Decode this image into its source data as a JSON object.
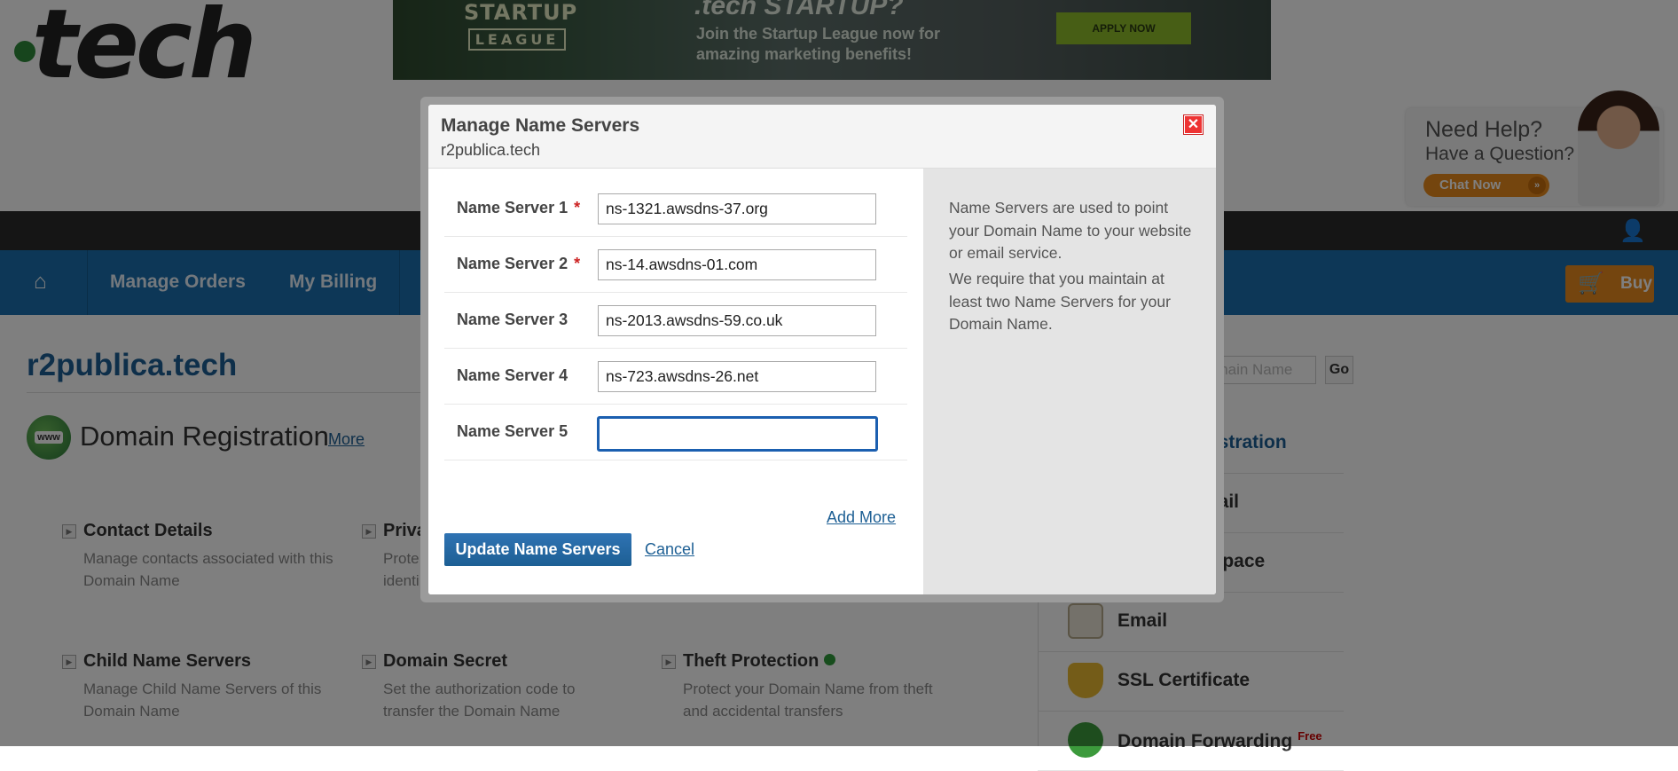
{
  "brand": {
    "logo_text": "tech"
  },
  "banner": {
    "league_line1": "STARTUP",
    "league_line2": "LEAGUE",
    "headline": ".tech STARTUP?",
    "subtext_line1": "Join the Startup League now for",
    "subtext_line2": "amazing marketing benefits!",
    "apply_label": "APPLY NOW"
  },
  "help_widget": {
    "line1": "Need Help?",
    "line2": "Have a Question?",
    "chat_label": "Chat Now"
  },
  "nav": {
    "items": [
      "Manage Orders",
      "My Billing"
    ],
    "buy_label": "Buy"
  },
  "domain_name": "r2publica.tech",
  "section": {
    "www_badge": "www",
    "title": "Domain Registration",
    "more_link": "More"
  },
  "cards": [
    {
      "title": "Contact Details",
      "desc": "Manage contacts associated with this Domain Name"
    },
    {
      "title": "Priva",
      "desc": "Prote identi"
    },
    {
      "title": "Child Name Servers",
      "desc": "Manage Child Name Servers of this Domain Name"
    },
    {
      "title": "Domain Secret",
      "desc": "Set the authorization code to transfer the Domain Name"
    },
    {
      "title": "Theft Protection",
      "desc": "Protect your Domain Name from theft and accidental transfers"
    }
  ],
  "sidebar": {
    "search_placeholder": "omain Name",
    "go_label": "Go",
    "items": [
      {
        "label": "gistration"
      },
      {
        "label": "mail"
      },
      {
        "label": "kspace"
      },
      {
        "label": "Email"
      },
      {
        "label": "SSL Certificate"
      },
      {
        "label": "Domain Forwarding",
        "badge": "Free"
      }
    ]
  },
  "modal": {
    "title": "Manage Name Servers",
    "subtitle": "r2publica.tech",
    "name_servers": [
      {
        "label": "Name Server 1",
        "required": "*",
        "value": "ns-1321.awsdns-37.org"
      },
      {
        "label": "Name Server 2",
        "required": "*",
        "value": "ns-14.awsdns-01.com"
      },
      {
        "label": "Name Server 3",
        "required": "",
        "value": "ns-2013.awsdns-59.co.uk"
      },
      {
        "label": "Name Server 4",
        "required": "",
        "value": "ns-723.awsdns-26.net"
      },
      {
        "label": "Name Server 5",
        "required": "",
        "value": ""
      }
    ],
    "add_more_label": "Add More",
    "update_label": "Update Name Servers",
    "cancel_label": "Cancel",
    "info_paragraph1": "Name Servers are used to point your Domain Name to your website or email service.",
    "info_paragraph2": "We require that you maintain at least two Name Servers for your Domain Name."
  },
  "colors": {
    "accent_blue": "#1b6fae",
    "link": "#1d5f94",
    "buy_orange": "#e98a1e",
    "required_red": "#cc2222"
  }
}
